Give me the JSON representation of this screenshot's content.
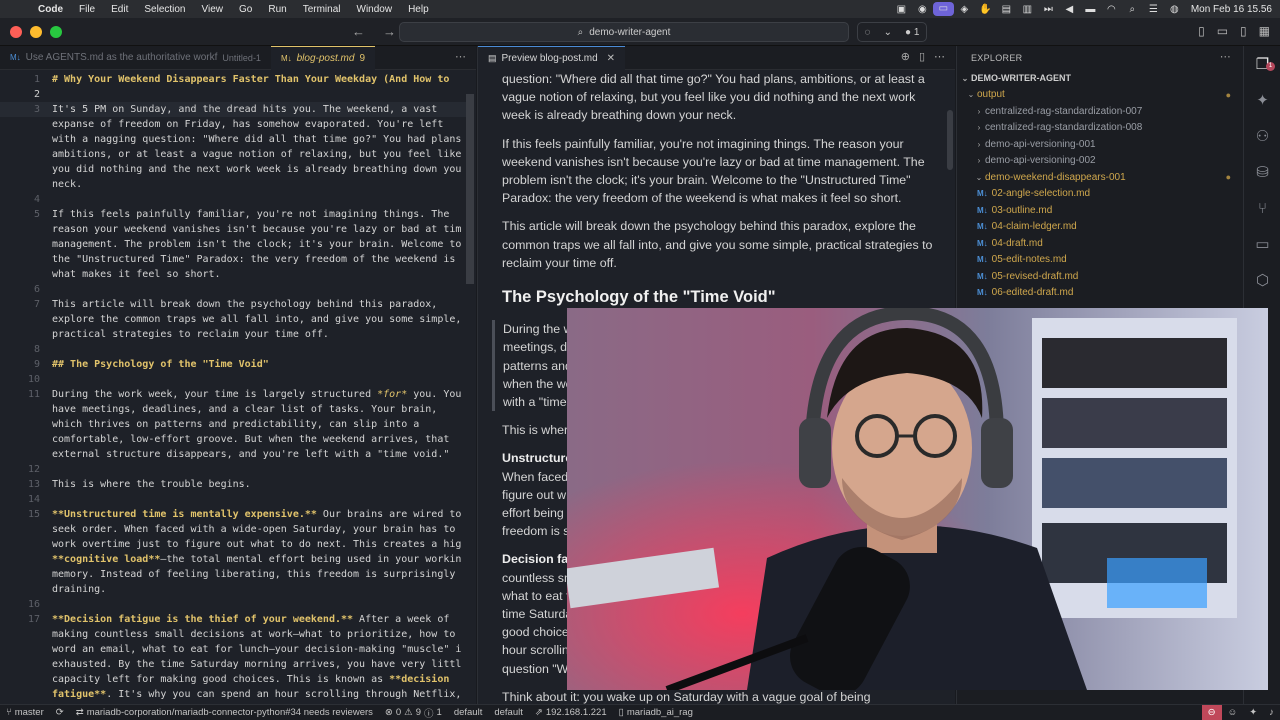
{
  "menubar": {
    "app_name": "Code",
    "items": [
      "File",
      "Edit",
      "Selection",
      "View",
      "Go",
      "Run",
      "Terminal",
      "Window",
      "Help"
    ],
    "clock": "Mon Feb 16  15.56"
  },
  "titlebar": {
    "search_label": "demo-writer-agent",
    "chat_count": "1"
  },
  "editor": {
    "tabs": [
      {
        "label": "Use AGENTS.md as the authoritative workf",
        "sub": "Untitled-1"
      },
      {
        "label": "blog-post.md",
        "badge": "9"
      }
    ],
    "lines": [
      {
        "n": "1",
        "text": "# Why Your Weekend Disappears Faster Than Your Weekday (And How to"
      },
      {
        "n": "2",
        "text": ""
      },
      {
        "n": "3",
        "text": "It's 5 PM on Sunday, and the dread hits you. The weekend, a vast"
      },
      {
        "n": "",
        "text": "expanse of freedom on Friday, has somehow evaporated. You're left"
      },
      {
        "n": "",
        "text": "with a nagging question: \"Where did all that time go?\" You had plans,"
      },
      {
        "n": "",
        "text": "ambitions, or at least a vague notion of relaxing, but you feel like"
      },
      {
        "n": "",
        "text": "you did nothing and the next work week is already breathing down your"
      },
      {
        "n": "",
        "text": "neck."
      },
      {
        "n": "4",
        "text": ""
      },
      {
        "n": "5",
        "text": "If this feels painfully familiar, you're not imagining things. The"
      },
      {
        "n": "",
        "text": "reason your weekend vanishes isn't because you're lazy or bad at time"
      },
      {
        "n": "",
        "text": "management. The problem isn't the clock; it's your brain. Welcome to"
      },
      {
        "n": "",
        "text": "the \"Unstructured Time\" Paradox: the very freedom of the weekend is"
      },
      {
        "n": "",
        "text": "what makes it feel so short."
      },
      {
        "n": "6",
        "text": ""
      },
      {
        "n": "7",
        "text": "This article will break down the psychology behind this paradox,"
      },
      {
        "n": "",
        "text": "explore the common traps we all fall into, and give you some simple,"
      },
      {
        "n": "",
        "text": "practical strategies to reclaim your time off."
      },
      {
        "n": "8",
        "text": ""
      },
      {
        "n": "9",
        "text": "## The Psychology of the \"Time Void\""
      },
      {
        "n": "10",
        "text": ""
      },
      {
        "n": "11",
        "pre": "During the work week, your time is largely structured ",
        "em": "*for*",
        "post": " you. You"
      },
      {
        "n": "",
        "text": "have meetings, deadlines, and a clear list of tasks. Your brain,"
      },
      {
        "n": "",
        "text": "which thrives on patterns and predictability, can slip into a"
      },
      {
        "n": "",
        "text": "comfortable, low-effort groove. But when the weekend arrives, that"
      },
      {
        "n": "",
        "text": "external structure disappears, and you're left with a \"time void.\""
      },
      {
        "n": "12",
        "text": ""
      },
      {
        "n": "13",
        "text": "This is where the trouble begins."
      },
      {
        "n": "14",
        "text": ""
      },
      {
        "n": "15",
        "bold": "**Unstructured time is mentally expensive.**",
        "post": " Our brains are wired to"
      },
      {
        "n": "",
        "text": "seek order. When faced with a wide-open Saturday, your brain has to"
      },
      {
        "n": "",
        "text": "work overtime just to figure out what to do next. This creates a high"
      },
      {
        "n": "",
        "bold": "**cognitive load**",
        "post": "—the total mental effort being used in your working"
      },
      {
        "n": "",
        "text": "memory. Instead of feeling liberating, this freedom is surprisingly"
      },
      {
        "n": "",
        "text": "draining."
      },
      {
        "n": "16",
        "text": ""
      },
      {
        "n": "17",
        "bold": "**Decision fatigue is the thief of your weekend.**",
        "post": " After a week of"
      },
      {
        "n": "",
        "text": "making countless small decisions at work—what to prioritize, how to"
      },
      {
        "n": "",
        "text": "word an email, what to eat for lunch—your decision-making \"muscle\" is"
      },
      {
        "n": "",
        "text": "exhausted. By the time Saturday morning arrives, you have very little"
      },
      {
        "n": "",
        "pre": "capacity left for making good choices. This is known as ",
        "bold": "**decision"
      },
      {
        "n": "",
        "bold": "fatigue**",
        "post": ". It's why you can spend an hour scrolling through Netflix,"
      }
    ]
  },
  "preview": {
    "tab_label": "Preview blog-post.md",
    "p1": "question: \"Where did all that time go?\" You had plans, ambitions, or at least a vague notion of relaxing, but you feel like you did nothing and the next work week is already breathing down your neck.",
    "p2": "If this feels painfully familiar, you're not imagining things. The reason your weekend vanishes isn't because you're lazy or bad at time management. The problem isn't the clock; it's your brain. Welcome to the \"Unstructured Time\" Paradox: the very freedom of the weekend is what makes it feel so short.",
    "p3": "This article will break down the psychology behind this paradox, explore the common traps we all fall into, and give you some simple, practical strategies to reclaim your time off.",
    "h2": "The Psychology of the \"Time Void\"",
    "q1": "During the w",
    "q2": "meetings, de",
    "q3": "patterns and",
    "q4": "when the we",
    "q5": "with a \"time",
    "p4": "This is wher",
    "s1": "Unstructure",
    "s1a": "When faced",
    "s1b": "figure out w",
    "s1c": "effort being",
    "s1d": "freedom is s",
    "s2": "Decision fat",
    "s2a": "countless sm",
    "s2b": "what to eat f",
    "s2c": "time Saturda",
    "s2d": "good choice",
    "s2e": "hour scrollin",
    "s2f": "question \"W",
    "p5": "Think about it: you wake up on Saturday with a vague goal of being"
  },
  "explorer": {
    "title": "EXPLORER",
    "root": "DEMO-WRITER-AGENT",
    "items": [
      {
        "label": "output",
        "kind": "folder-open"
      },
      {
        "label": "centralized-rag-standardization-007",
        "kind": "folder"
      },
      {
        "label": "centralized-rag-standardization-008",
        "kind": "folder"
      },
      {
        "label": "demo-api-versioning-001",
        "kind": "folder"
      },
      {
        "label": "demo-api-versioning-002",
        "kind": "folder"
      },
      {
        "label": "demo-weekend-disappears-001",
        "kind": "folder-open"
      },
      {
        "label": "02-angle-selection.md",
        "kind": "file"
      },
      {
        "label": "03-outline.md",
        "kind": "file"
      },
      {
        "label": "04-claim-ledger.md",
        "kind": "file"
      },
      {
        "label": "04-draft.md",
        "kind": "file"
      },
      {
        "label": "05-edit-notes.md",
        "kind": "file"
      },
      {
        "label": "05-revised-draft.md",
        "kind": "file"
      },
      {
        "label": "06-edited-draft.md",
        "kind": "file"
      }
    ]
  },
  "statusbar": {
    "branch": "master",
    "pr": "mariadb-corporation/mariadb-connector-python#34 needs reviewers",
    "errors": "0",
    "warnings": "9",
    "infos": "1",
    "profile1": "default",
    "profile2": "default",
    "ip": "192.168.1.221",
    "db": "mariadb_ai_rag"
  },
  "colors": {
    "accent_yellow": "#e1c36b",
    "md_icon_blue": "#4c8fd6",
    "status_warn": "#c0485a"
  }
}
